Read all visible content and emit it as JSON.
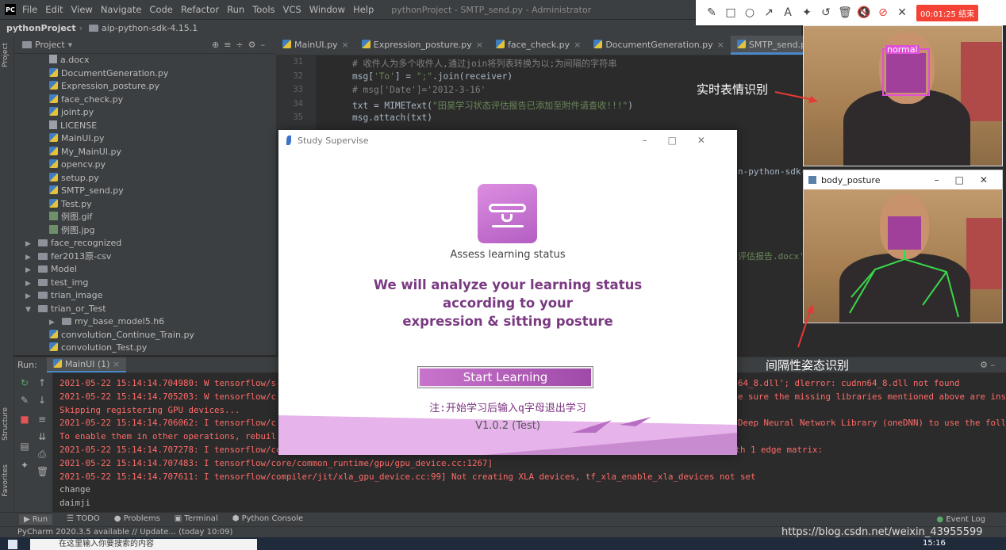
{
  "menubar": {
    "items": [
      "File",
      "Edit",
      "View",
      "Navigate",
      "Code",
      "Refactor",
      "Run",
      "Tools",
      "VCS",
      "Window",
      "Help"
    ],
    "window_title": "pythonProject - SMTP_send.py - Administrator"
  },
  "breadcrumb": {
    "project": "pythonProject",
    "folder": "aip-python-sdk-4.15.1"
  },
  "left_strip": {
    "project": "Project",
    "structure": "Structure",
    "favorites": "Favorites"
  },
  "project_panel": {
    "title": "Project",
    "tree": [
      {
        "name": "a.docx",
        "icon": "txt",
        "indent": 2
      },
      {
        "name": "DocumentGeneration.py",
        "icon": "py",
        "indent": 2
      },
      {
        "name": "Expression_posture.py",
        "icon": "py",
        "indent": 2
      },
      {
        "name": "face_check.py",
        "icon": "py",
        "indent": 2
      },
      {
        "name": "joint.py",
        "icon": "py",
        "indent": 2
      },
      {
        "name": "LICENSE",
        "icon": "txt",
        "indent": 2
      },
      {
        "name": "MainUI.py",
        "icon": "py",
        "indent": 2
      },
      {
        "name": "My_MainUI.py",
        "icon": "py",
        "indent": 2
      },
      {
        "name": "opencv.py",
        "icon": "py",
        "indent": 2
      },
      {
        "name": "setup.py",
        "icon": "py",
        "indent": 2
      },
      {
        "name": "SMTP_send.py",
        "icon": "py",
        "indent": 2
      },
      {
        "name": "Test.py",
        "icon": "py",
        "indent": 2
      },
      {
        "name": "例图.gif",
        "icon": "img",
        "indent": 2
      },
      {
        "name": "例图.jpg",
        "icon": "img",
        "indent": 2
      },
      {
        "name": "face_recognized",
        "icon": "folder",
        "indent": 1,
        "arrow": "▶"
      },
      {
        "name": "fer2013原-csv",
        "icon": "folder",
        "indent": 1,
        "arrow": "▶"
      },
      {
        "name": "Model",
        "icon": "folder",
        "indent": 1,
        "arrow": "▶"
      },
      {
        "name": "test_img",
        "icon": "folder",
        "indent": 1,
        "arrow": "▶"
      },
      {
        "name": "trian_image",
        "icon": "folder",
        "indent": 1,
        "arrow": "▶"
      },
      {
        "name": "trian_or_Test",
        "icon": "folder",
        "indent": 1,
        "arrow": "▼"
      },
      {
        "name": "my_base_model5.h6",
        "icon": "folder",
        "indent": 2,
        "arrow": "▶"
      },
      {
        "name": "convolution_Continue_Train.py",
        "icon": "py",
        "indent": 2
      },
      {
        "name": "convolution_Test.py",
        "icon": "py",
        "indent": 2
      }
    ]
  },
  "editor": {
    "tabs": [
      {
        "label": "MainUI.py",
        "active": false
      },
      {
        "label": "Expression_posture.py",
        "active": false
      },
      {
        "label": "face_check.py",
        "active": false
      },
      {
        "label": "DocumentGeneration.py",
        "active": false
      },
      {
        "label": "SMTP_send.py",
        "active": true
      }
    ],
    "lines": [
      {
        "num": "31",
        "parts": [
          {
            "t": "# 收件人为多个收件人,通过join将列表转换为以;为间隔的字符串",
            "c": "cm"
          }
        ]
      },
      {
        "num": "32",
        "parts": [
          {
            "t": "msg[",
            "c": ""
          },
          {
            "t": "'To'",
            "c": "st"
          },
          {
            "t": "] = ",
            "c": ""
          },
          {
            "t": "\";\"",
            "c": "st"
          },
          {
            "t": ".join(receiver)",
            "c": ""
          }
        ]
      },
      {
        "num": "33",
        "parts": [
          {
            "t": "# msg['Date']='2012-3-16'",
            "c": "cm"
          }
        ]
      },
      {
        "num": "34",
        "parts": [
          {
            "t": "txt = MIMEText(",
            "c": ""
          },
          {
            "t": "\"田昊学习状态评估报告已添加至附件请查收!!!\"",
            "c": "st"
          },
          {
            "t": ")",
            "c": ""
          }
        ]
      },
      {
        "num": "35",
        "parts": [
          {
            "t": "msg.attach(txt)",
            "c": ""
          }
        ]
      }
    ],
    "side_frag_1": "n-python-sdk-",
    "side_frag_2": "评估报告.docx'"
  },
  "run_panel": {
    "label": "Run:",
    "tab": "MainUI (1)",
    "log_lines": [
      {
        "text": "2021-05-22 15:14:14.704980: W tensorflow/s",
        "tail": "64_8.dll'; dlerror: cudnn64_8.dll not found",
        "type": "err"
      },
      {
        "text": "2021-05-22 15:14:14.705203: W tensorflow/c",
        "tail": "e sure the missing libraries mentioned above are ins",
        "type": "err"
      },
      {
        "text": "Skipping registering GPU devices...",
        "tail": "",
        "type": "err"
      },
      {
        "text": "2021-05-22 15:14:14.706062: I tensorflow/c",
        "tail": "Deep Neural Network Library (oneDNN) to use the foll",
        "type": "err"
      },
      {
        "text": "To enable them in other operations, rebuil",
        "tail": "",
        "type": "err"
      },
      {
        "text": "2021-05-22 15:14:14.707278: I tensorflow/core/common_runtime/gpu/gpu_device.cc:1261] Device interconnect StreamExecutor with strength 1 edge matrix:",
        "tail": "",
        "type": "err"
      },
      {
        "text": "2021-05-22 15:14:14.707483: I tensorflow/core/common_runtime/gpu/gpu_device.cc:1267]",
        "tail": "",
        "type": "err"
      },
      {
        "text": "2021-05-22 15:14:14.707611: I tensorflow/compiler/jit/xla_gpu_device.cc:99] Not creating XLA devices, tf_xla_enable_xla_devices not set",
        "tail": "",
        "type": "err"
      },
      {
        "text": "change",
        "tail": "",
        "type": "plain"
      },
      {
        "text": "daimji",
        "tail": "",
        "type": "plain"
      }
    ]
  },
  "bottom_tools": [
    "Run",
    "TODO",
    "Problems",
    "Terminal",
    "Python Console"
  ],
  "event_log": "Event Log",
  "status": {
    "text": "PyCharm 2020.3.5 available // Update... (today 10:09)",
    "watermark": "https://blog.csdn.net/weixin_43955599"
  },
  "taskbar": {
    "search_placeholder": "在这里输入你要搜索的内容",
    "clock": "15:16"
  },
  "annot_toolbar": {
    "timer": "00:01:25 结束"
  },
  "camera": {
    "top_label": "normal",
    "window2_title": "body_posture"
  },
  "labels": {
    "realtime": "实时表情识别",
    "posture": "间隔性姿态识别"
  },
  "dialog": {
    "title": "Study Supervise",
    "assess": "Assess learning status",
    "headline_1": "We will analyze your learning status",
    "headline_2": "according to your",
    "headline_3": "expression & sitting posture",
    "start_button": "Start Learning",
    "note": "注:开始学习后输入q字母退出学习",
    "version": "V1.0.2 (Test)"
  },
  "colors": {
    "accent": "#b35ec2",
    "headline": "#7a3a82",
    "annotation_red": "#e53935"
  }
}
